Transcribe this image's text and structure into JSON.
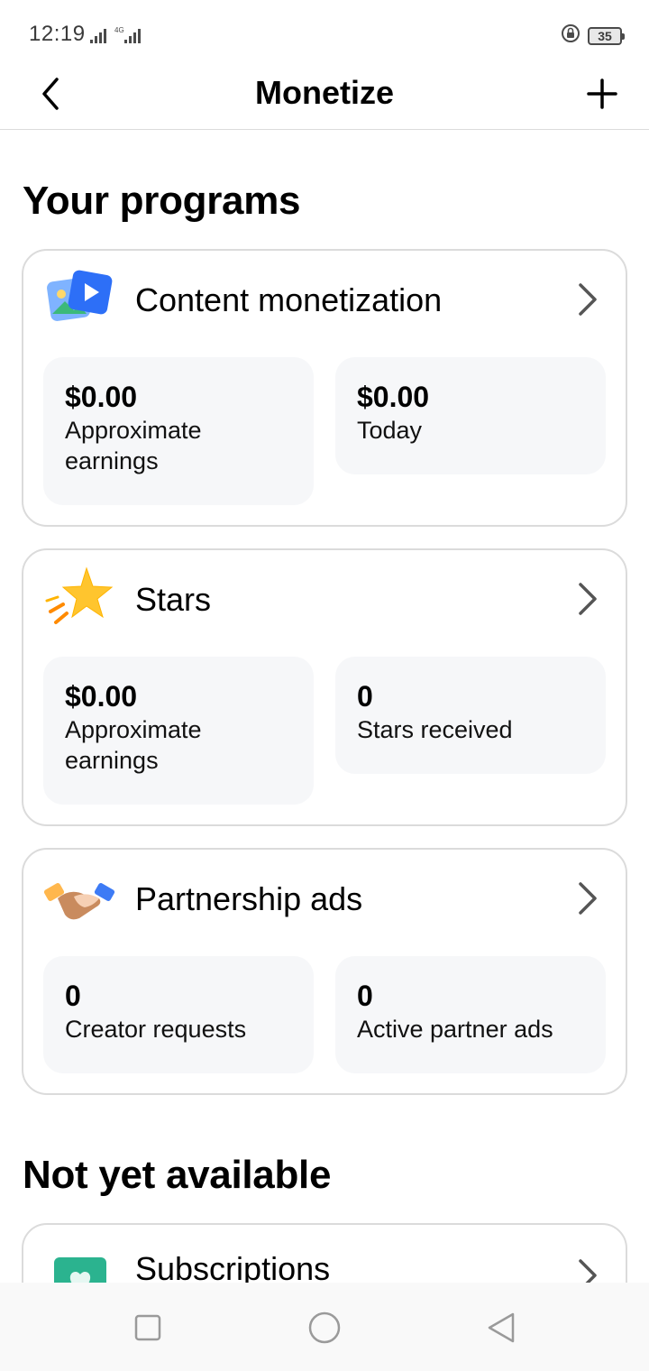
{
  "status_bar": {
    "time": "12:19",
    "network": "4G",
    "battery": "35"
  },
  "header": {
    "title": "Monetize",
    "back_icon": "chevron-left-icon",
    "add_icon": "plus-icon"
  },
  "sections": {
    "your_programs": "Your programs",
    "not_yet_available": "Not yet available"
  },
  "programs": [
    {
      "title": "Content monetization",
      "icon": "photo-video-icon",
      "stats": [
        {
          "value": "$0.00",
          "label": "Approximate earnings"
        },
        {
          "value": "$0.00",
          "label": "Today"
        }
      ]
    },
    {
      "title": "Stars",
      "icon": "star-icon",
      "stats": [
        {
          "value": "$0.00",
          "label": "Approximate earnings"
        },
        {
          "value": "0",
          "label": "Stars received"
        }
      ]
    },
    {
      "title": "Partnership ads",
      "icon": "handshake-icon",
      "stats": [
        {
          "value": "0",
          "label": "Creator requests"
        },
        {
          "value": "0",
          "label": "Active partner ads"
        }
      ]
    }
  ],
  "unavailable": [
    {
      "title": "Subscriptions",
      "icon": "heart-card-icon"
    }
  ],
  "nav": {
    "recents_icon": "square-icon",
    "home_icon": "circle-icon",
    "back_icon": "triangle-back-icon"
  },
  "colors": {
    "card_border": "#dbdbdb",
    "stat_bg": "#f6f7f9",
    "star": "#ffc52e",
    "subscriptions": "#2bb38f"
  }
}
